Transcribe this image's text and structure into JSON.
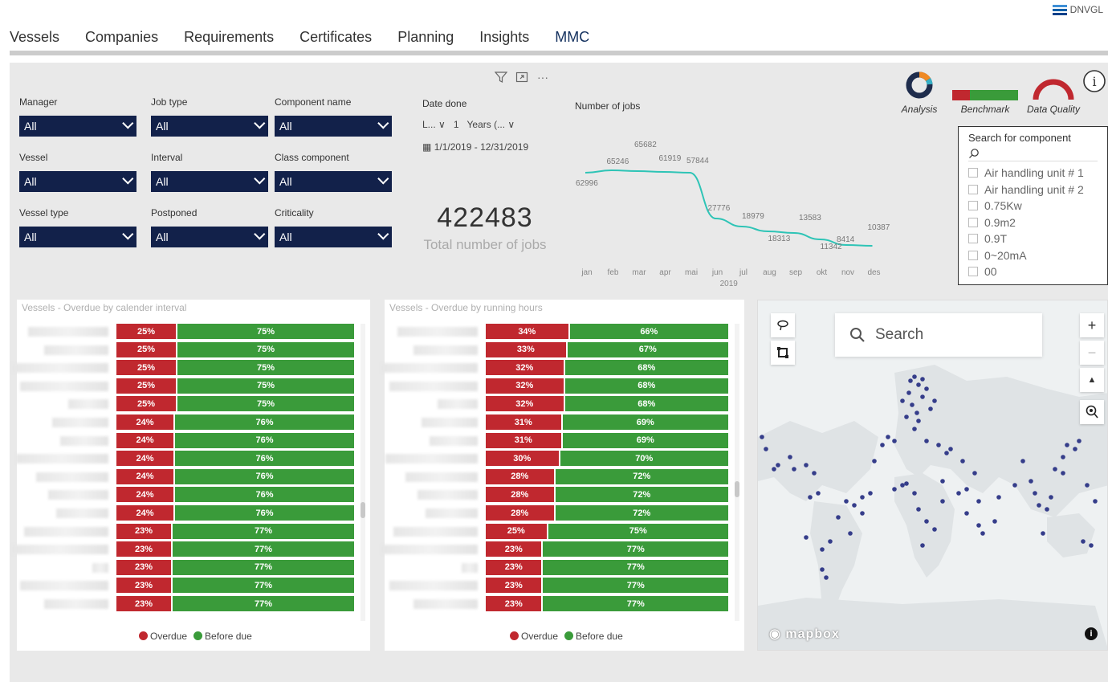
{
  "brand": {
    "text": "DNVGL"
  },
  "nav": {
    "tabs": [
      "Vessels",
      "Companies",
      "Requirements",
      "Certificates",
      "Planning",
      "Insights",
      "MMC"
    ],
    "active": "MMC"
  },
  "filters": [
    {
      "label": "Manager",
      "value": "All"
    },
    {
      "label": "Job type",
      "value": "All"
    },
    {
      "label": "Component name",
      "value": "All"
    },
    {
      "label": "Vessel",
      "value": "All"
    },
    {
      "label": "Interval",
      "value": "All"
    },
    {
      "label": "Class component",
      "value": "All"
    },
    {
      "label": "Vessel type",
      "value": "All"
    },
    {
      "label": "Postponed",
      "value": "All"
    },
    {
      "label": "Criticality",
      "value": "All"
    }
  ],
  "date_filter": {
    "label": "Date done",
    "mode": "L...",
    "count": "1",
    "unit": "Years (...",
    "range": "1/1/2019 - 12/31/2019"
  },
  "kpi": {
    "value": "422483",
    "caption": "Total number of jobs"
  },
  "chart_data": [
    {
      "type": "line",
      "title": "Number of jobs",
      "categories": [
        "jan",
        "feb",
        "mar",
        "apr",
        "mai",
        "jun",
        "jul",
        "aug",
        "sep",
        "okt",
        "nov",
        "des"
      ],
      "x_year": "2019",
      "values": [
        62996,
        65246,
        65682,
        61919,
        57844,
        27776,
        18979,
        18313,
        13583,
        11342,
        8414,
        10387
      ],
      "color": "#2ec4b6"
    },
    {
      "type": "bar",
      "title": "Vessels - Overdue by calender interval",
      "stacked": true,
      "series": [
        {
          "name": "Overdue",
          "color": "#c0282f",
          "values": [
            25,
            25,
            25,
            25,
            25,
            24,
            24,
            24,
            24,
            24,
            24,
            23,
            23,
            23,
            23,
            23
          ]
        },
        {
          "name": "Before due",
          "color": "#3a9b3a",
          "values": [
            75,
            75,
            75,
            75,
            75,
            76,
            76,
            76,
            76,
            76,
            76,
            77,
            77,
            77,
            77,
            77
          ]
        }
      ],
      "unit": "%"
    },
    {
      "type": "bar",
      "title": "Vessels - Overdue by running hours",
      "stacked": true,
      "series": [
        {
          "name": "Overdue",
          "color": "#c0282f",
          "values": [
            34,
            33,
            32,
            32,
            32,
            31,
            31,
            30,
            28,
            28,
            28,
            25,
            23,
            23,
            23,
            23
          ]
        },
        {
          "name": "Before due",
          "color": "#3a9b3a",
          "values": [
            66,
            67,
            68,
            68,
            68,
            69,
            69,
            70,
            72,
            72,
            72,
            75,
            77,
            77,
            77,
            77
          ]
        }
      ],
      "unit": "%"
    }
  ],
  "legend": {
    "overdue": "Overdue",
    "before_due": "Before due"
  },
  "visual_icons": [
    {
      "name": "Analysis",
      "icon": "donut-icon"
    },
    {
      "name": "Benchmark",
      "icon": "benchmark-bar-icon"
    },
    {
      "name": "Data Quality",
      "icon": "gauge-icon"
    }
  ],
  "component_search": {
    "title": "Search for component",
    "items": [
      "Air handling unit # 1",
      "Air handling unit # 2",
      "0.75Kw",
      "0.9m2",
      "0.9T",
      "0~20mA",
      "00"
    ]
  },
  "map": {
    "search_placeholder": "Search",
    "attribution": "mapbox"
  }
}
